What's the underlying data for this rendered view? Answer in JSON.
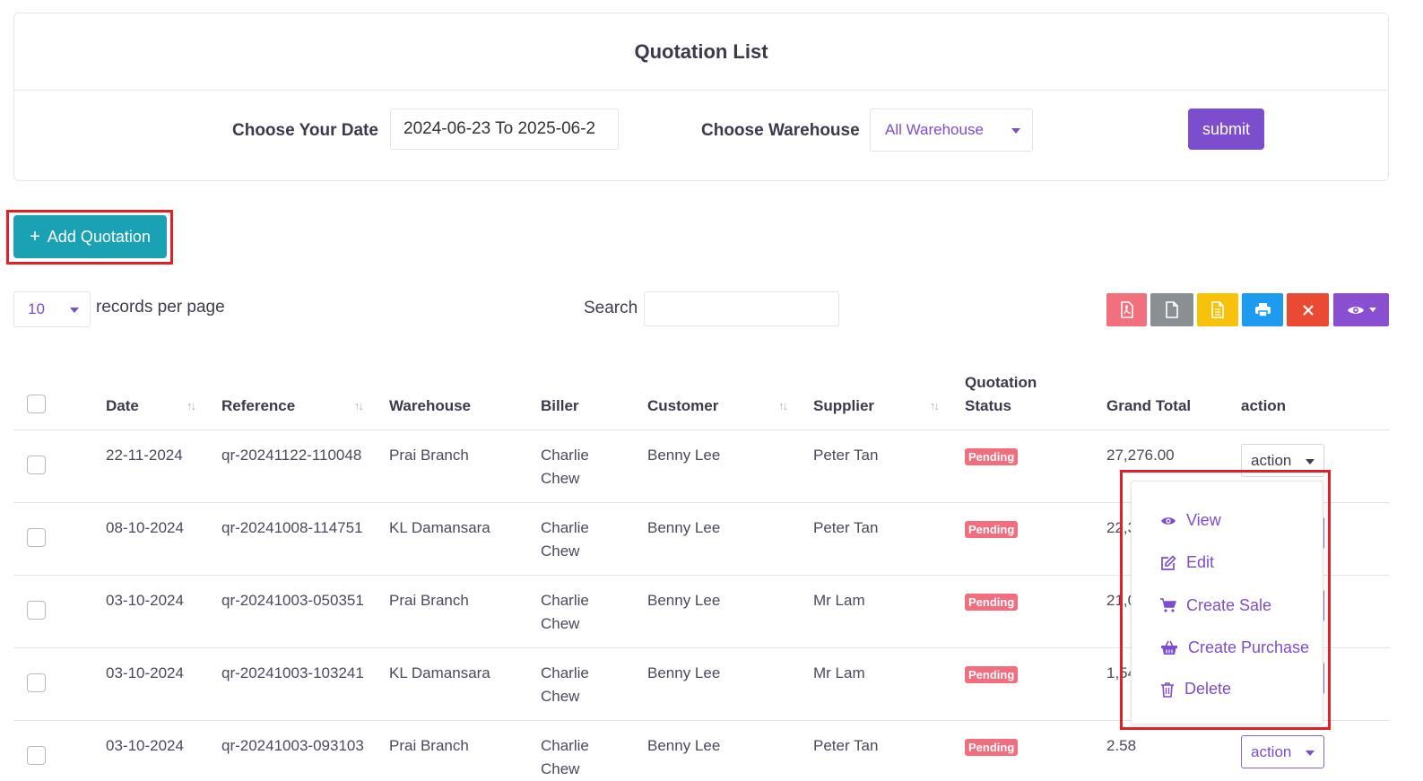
{
  "page": {
    "title": "Quotation List",
    "date_label": "Choose Your Date",
    "date_value": "2024-06-23 To 2025-06-2",
    "warehouse_label": "Choose Warehouse",
    "warehouse_value": "All Warehouse",
    "submit_label": "submit"
  },
  "toolbar": {
    "add_label": "Add Quotation",
    "records_per_page_value": "10",
    "records_per_page_text": "records per page",
    "search_label": "Search",
    "search_value": "",
    "buttons": [
      {
        "name": "pdf-export",
        "icon": "pdf-icon",
        "color": "#f2707e"
      },
      {
        "name": "csv-export",
        "icon": "file-icon",
        "color": "#8a8f94"
      },
      {
        "name": "excel-export",
        "icon": "excel-icon",
        "color": "#f9c20a"
      },
      {
        "name": "print",
        "icon": "print-icon",
        "color": "#1d9bf0"
      },
      {
        "name": "delete",
        "icon": "close-icon",
        "color": "#ea4a33"
      },
      {
        "name": "column-visibility",
        "icon": "eye-icon",
        "color": "#8a4fd0"
      }
    ]
  },
  "table": {
    "columns": [
      "Date",
      "Reference",
      "Warehouse",
      "Biller",
      "Customer",
      "Supplier",
      "Quotation",
      "Status",
      "Grand Total",
      "action"
    ],
    "rows": [
      {
        "date": "22-11-2024",
        "reference": "qr-20241122-110048",
        "warehouse": "Prai Branch",
        "biller_first": "Charlie",
        "biller_last": "Chew",
        "customer": "Benny Lee",
        "supplier": "Peter Tan",
        "status": "Pending",
        "grand_total": "27,276.00",
        "action": "action"
      },
      {
        "date": "08-10-2024",
        "reference": "qr-20241008-114751",
        "warehouse": "KL Damansara",
        "biller_first": "Charlie",
        "biller_last": "Chew",
        "customer": "Benny Lee",
        "supplier": "Peter Tan",
        "status": "Pending",
        "grand_total": "22,3",
        "action": "action"
      },
      {
        "date": "03-10-2024",
        "reference": "qr-20241003-050351",
        "warehouse": "Prai Branch",
        "biller_first": "Charlie",
        "biller_last": "Chew",
        "customer": "Benny Lee",
        "supplier": "Mr Lam",
        "status": "Pending",
        "grand_total": "21,0",
        "action": "action"
      },
      {
        "date": "03-10-2024",
        "reference": "qr-20241003-103241",
        "warehouse": "KL Damansara",
        "biller_first": "Charlie",
        "biller_last": "Chew",
        "customer": "Benny Lee",
        "supplier": "Mr Lam",
        "status": "Pending",
        "grand_total": "1,54",
        "action": "action"
      },
      {
        "date": "03-10-2024",
        "reference": "qr-20241003-093103",
        "warehouse": "Prai Branch",
        "biller_first": "Charlie",
        "biller_last": "Chew",
        "customer": "Benny Lee",
        "supplier": "Peter Tan",
        "status": "Pending",
        "grand_total": "2.58",
        "action": "action"
      }
    ]
  },
  "dropdown": {
    "items": [
      {
        "label": "View",
        "icon": "eye-icon"
      },
      {
        "label": "Edit",
        "icon": "edit-icon"
      },
      {
        "label": "Create Sale",
        "icon": "cart-icon"
      },
      {
        "label": "Create Purchase",
        "icon": "basket-icon"
      },
      {
        "label": "Delete",
        "icon": "trash-icon"
      }
    ]
  },
  "colors": {
    "accent": "#7c4dcc",
    "add_button": "#1aa1b3",
    "pending_badge": "#f26d7d",
    "highlight": "#e21f26"
  }
}
